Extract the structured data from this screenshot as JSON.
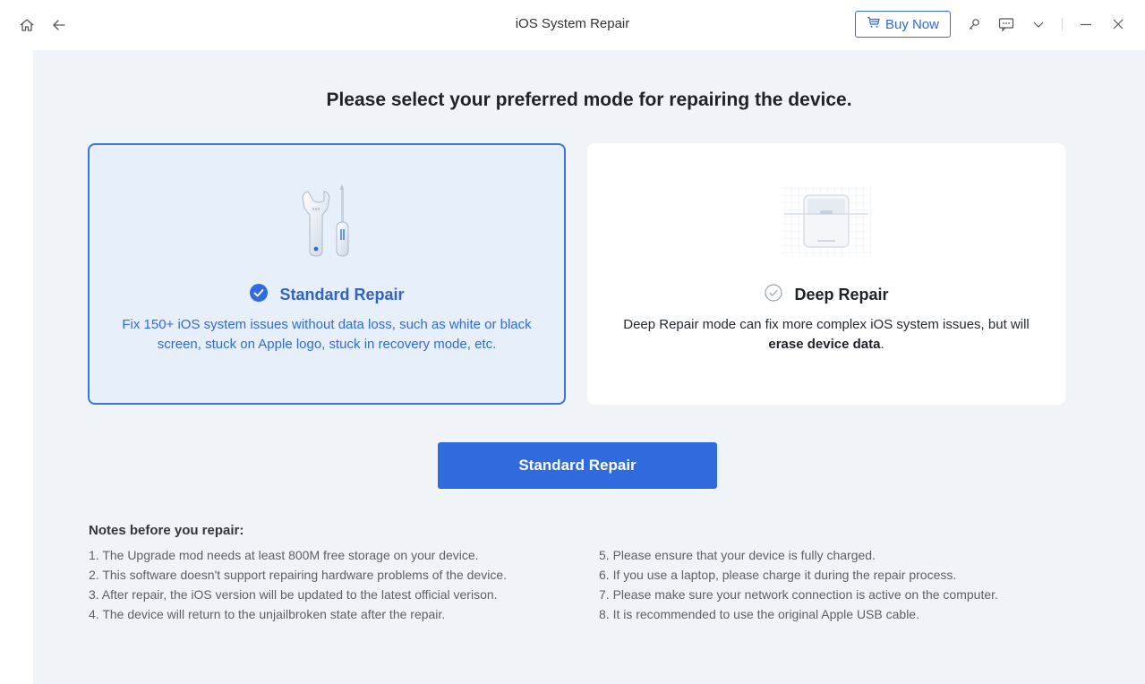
{
  "titlebar": {
    "title": "iOS System Repair",
    "buy_label": "Buy Now",
    "icons": [
      "home-icon",
      "back-arrow-icon",
      "cart-icon",
      "key-icon",
      "feedback-icon",
      "chevron-down-icon",
      "minimize-icon",
      "close-icon"
    ]
  },
  "heading": "Please select your preferred mode for repairing the device.",
  "modes": {
    "standard": {
      "title": "Standard Repair",
      "description": "Fix 150+ iOS system issues without data loss, such as white or black screen, stuck on Apple logo, stuck in recovery mode, etc.",
      "selected": true
    },
    "deep": {
      "title": "Deep Repair",
      "description_prefix": "Deep Repair mode can fix more complex iOS system issues, but will ",
      "description_bold": "erase device data",
      "description_suffix": ".",
      "selected": false
    }
  },
  "primary_button": "Standard Repair",
  "notes": {
    "title": "Notes before you repair:",
    "left": [
      "1. The Upgrade mod needs at least 800M free storage on your device.",
      "2. This software doesn't support repairing hardware problems of the device.",
      "3. After repair, the iOS version will be updated to the latest official verison.",
      "4. The device will return to the unjailbroken state after the repair."
    ],
    "right": [
      "5. Please ensure that your device is fully charged.",
      "6. If you use a laptop, please charge it during the repair process.",
      "7. Please make sure your network connection is active on the computer.",
      "8. It is recommended to use the original Apple USB cable."
    ]
  },
  "colors": {
    "accent": "#2f6bde",
    "background": "#f0f3f7",
    "selected_card": "#e7effb"
  }
}
